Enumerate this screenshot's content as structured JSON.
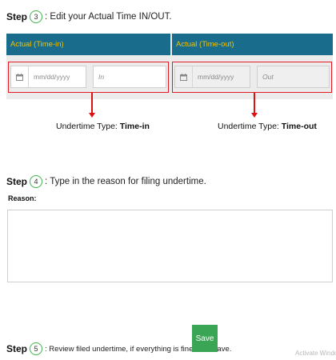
{
  "step3": {
    "word": "Step",
    "number": "3",
    "text": ": Edit your Actual Time IN/OUT."
  },
  "table": {
    "header_in": "Actual (Time-in)",
    "header_out": "Actual (Time-out)",
    "in_row": {
      "date_placeholder": "mm/dd/yyyy",
      "time_placeholder": "In"
    },
    "out_row": {
      "date_placeholder": "mm/dd/yyyy",
      "time_placeholder": "Out"
    }
  },
  "captions": {
    "in_prefix": "Undertime Type: ",
    "in_value": "Time-in",
    "out_prefix": "Undertime Type: ",
    "out_value": "Time-out"
  },
  "step4": {
    "word": "Step",
    "number": "4",
    "text": ": Type in the reason for filing undertime."
  },
  "reason": {
    "label": "Reason:",
    "value": ""
  },
  "step5": {
    "word": "Step",
    "number": "5",
    "text": ": Review filed undertime, if everything is fine click Save."
  },
  "save_button": {
    "label": "Save"
  },
  "watermark": {
    "text": "Activate Window"
  },
  "colors": {
    "header_bg": "#1a6c8c",
    "header_text": "#f2c200",
    "highlight": "#e01b24",
    "save_bg": "#3aa655",
    "step_circle": "#3cb44a"
  },
  "icons": {
    "date_picker": "calendar-icon"
  }
}
